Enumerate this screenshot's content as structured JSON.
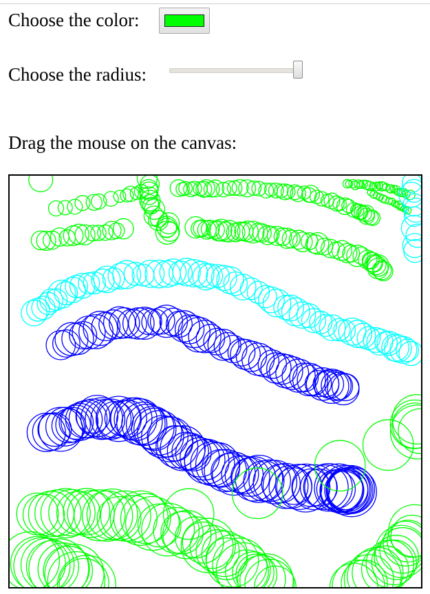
{
  "controls": {
    "color_label": "Choose the color:",
    "color_value": "#00ff00",
    "radius_label": "Choose the radius:",
    "radius_level": 1.0,
    "instruction": "Drag the mouse on the canvas:"
  },
  "colors": {
    "green": "#00ff00",
    "cyan": "#00ffff",
    "blue": "#0000ff"
  }
}
